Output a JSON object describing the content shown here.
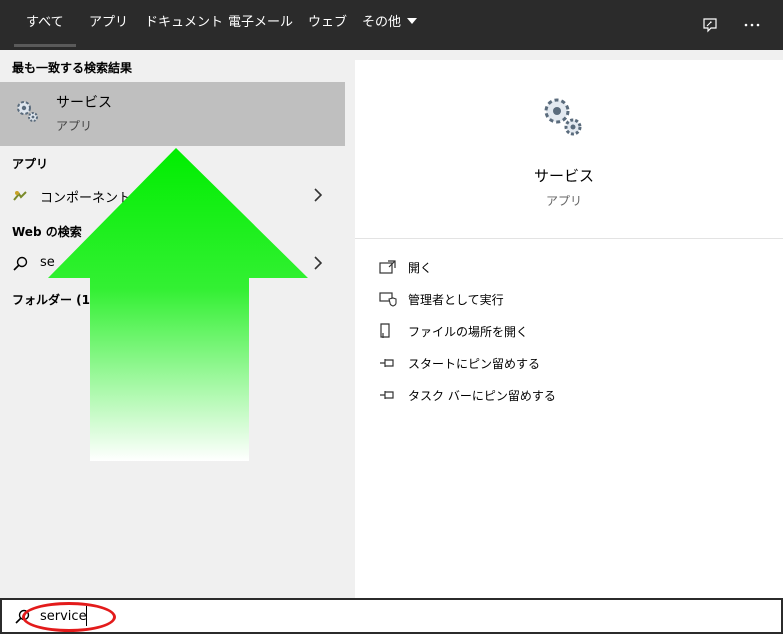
{
  "tabs": [
    "すべて",
    "アプリ",
    "ドキュメント",
    "電子メール",
    "ウェブ",
    "その他"
  ],
  "top_icons": [
    "feedback-icon",
    "more-icon"
  ],
  "left": {
    "best_match_header": "最も一致する検索結果",
    "best_match": {
      "title": "サービス",
      "subtitle": "アプリ"
    },
    "apps_header": "アプリ",
    "apps_item": "コンポーネント サ",
    "web_header": "Web の検索",
    "web_item": "se",
    "folders_header": "フォルダー (15+"
  },
  "right": {
    "title": "サービス",
    "subtitle": "アプリ",
    "actions": [
      "開く",
      "管理者として実行",
      "ファイルの場所を開く",
      "スタートにピン留めする",
      "タスク バーにピン留めする"
    ]
  },
  "search": {
    "value": "service"
  },
  "colors": {
    "topbar": "#2b2b2b",
    "selected_row": "#bfbfbf",
    "annotation_ring": "#e31b1b",
    "arrow": "#00ee00"
  }
}
